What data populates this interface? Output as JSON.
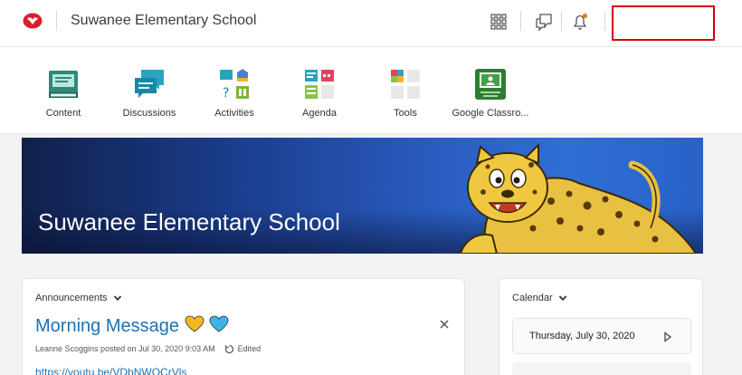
{
  "header": {
    "school_name": "Suwanee Elementary School",
    "logo_icon": "brightspace-logo-icon",
    "icons": [
      "apps-grid-icon",
      "message-alerts-icon",
      "notification-bell-icon"
    ]
  },
  "nav": {
    "items": [
      {
        "label": "Content",
        "icon": "book-icon"
      },
      {
        "label": "Discussions",
        "icon": "chat-bubbles-icon"
      },
      {
        "label": "Activities",
        "icon": "activities-icon"
      },
      {
        "label": "Agenda",
        "icon": "calendar-checklist-icon"
      },
      {
        "label": "Tools",
        "icon": "tools-grid-icon"
      },
      {
        "label": "Google Classro...",
        "icon": "google-classroom-icon"
      }
    ]
  },
  "banner": {
    "title": "Suwanee Elementary School",
    "image": "leopard-mascot"
  },
  "announcements": {
    "heading": "Announcements",
    "title": "Morning Message",
    "meta": "Leanne Scoggins posted on Jul 30, 2020 9:03 AM",
    "edited_label": "Edited",
    "link": "https://youtu.be/VDbNWOCrVls"
  },
  "calendar": {
    "heading": "Calendar",
    "date": "Thursday, July 30, 2020"
  },
  "colors": {
    "accent": "#1a73b5",
    "highlight_box": "#d40000"
  }
}
